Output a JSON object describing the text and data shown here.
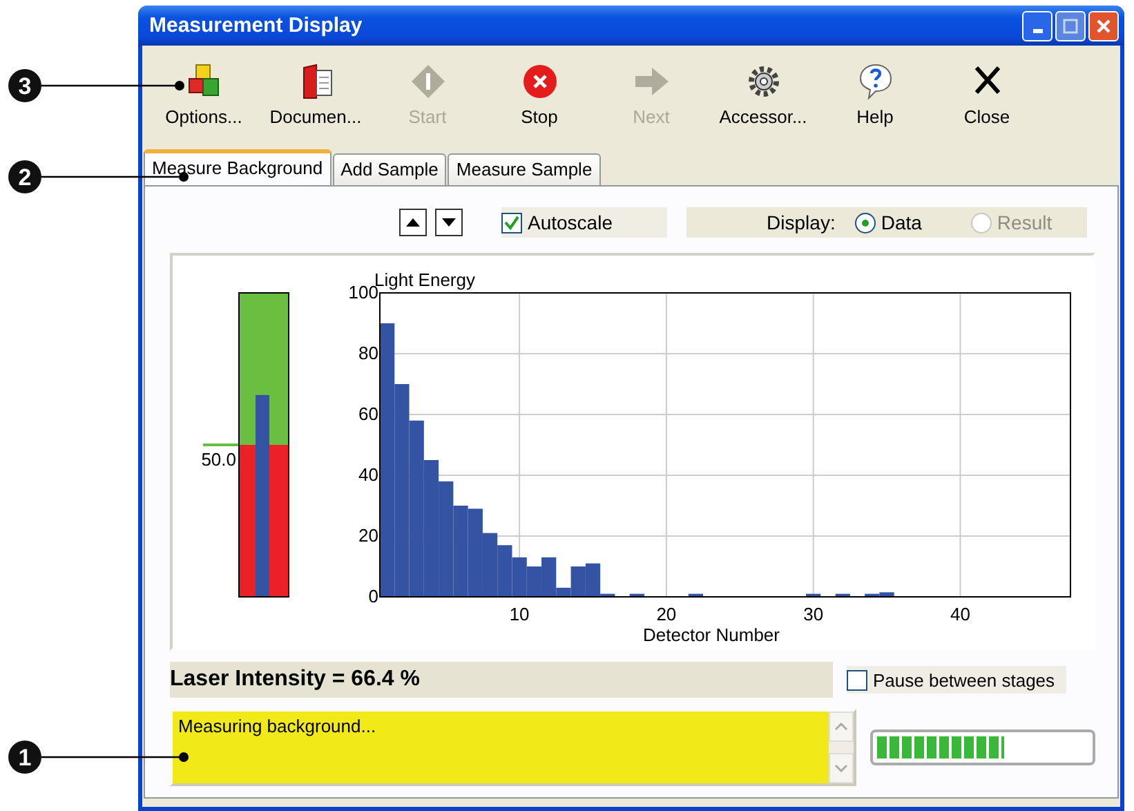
{
  "window": {
    "title": "Measurement Display"
  },
  "toolbar": [
    {
      "label": "Options...",
      "kind": "options",
      "disabled": false
    },
    {
      "label": "Documen...",
      "kind": "documents",
      "disabled": false
    },
    {
      "label": "Start",
      "kind": "start",
      "disabled": true
    },
    {
      "label": "Stop",
      "kind": "stop",
      "disabled": false
    },
    {
      "label": "Next",
      "kind": "next",
      "disabled": true
    },
    {
      "label": "Accessor...",
      "kind": "accessories",
      "disabled": false
    },
    {
      "label": "Help",
      "kind": "help",
      "disabled": false
    },
    {
      "label": "Close",
      "kind": "close",
      "disabled": false
    }
  ],
  "tabs": [
    {
      "label": "Measure Background",
      "selected": true
    },
    {
      "label": "Add Sample",
      "selected": false
    },
    {
      "label": "Measure Sample",
      "selected": false
    }
  ],
  "autoscale": {
    "label": "Autoscale",
    "checked": true
  },
  "display": {
    "label": "Display:",
    "options": [
      {
        "label": "Data",
        "selected": true,
        "disabled": false
      },
      {
        "label": "Result",
        "selected": false,
        "disabled": true
      }
    ]
  },
  "gauge": {
    "level": 0.664,
    "threshold": {
      "label": "50.0",
      "level": 0.5
    }
  },
  "chart_data": {
    "type": "bar",
    "ylabel": "Light Energy",
    "xlabel": "Detector Number",
    "x": [
      1,
      2,
      3,
      4,
      5,
      6,
      7,
      8,
      9,
      10,
      11,
      12,
      13,
      14,
      15,
      16,
      17,
      18,
      19,
      20,
      21,
      22,
      23,
      24,
      25,
      26,
      27,
      28,
      29,
      30,
      31,
      32,
      33,
      34,
      35,
      36,
      37,
      38,
      39,
      40,
      41,
      42,
      43,
      44,
      45,
      46,
      47
    ],
    "values": [
      90,
      70,
      58,
      45,
      38,
      30,
      29,
      21,
      17,
      13,
      10,
      13,
      3,
      10,
      11,
      1,
      0,
      1,
      0,
      0,
      0,
      1,
      0,
      0,
      0,
      0,
      0,
      0,
      0,
      1,
      0,
      1,
      0,
      1,
      1.5,
      0,
      0,
      0,
      0,
      0,
      0,
      0,
      0,
      0,
      0,
      0,
      0
    ],
    "grid": true,
    "xlim": [
      0.5,
      47.5
    ],
    "ylim": [
      0,
      100
    ],
    "xticks": [
      10,
      20,
      30,
      40
    ],
    "yticks": [
      0,
      20,
      40,
      60,
      80,
      100
    ]
  },
  "laser_intensity": "Laser Intensity = 66.4 %",
  "pause": {
    "label": "Pause between stages",
    "checked": false
  },
  "status": {
    "message": "Measuring background..."
  },
  "progress": {
    "level": 0.6
  },
  "callouts": [
    {
      "number": "3"
    },
    {
      "number": "2"
    },
    {
      "number": "1"
    }
  ]
}
